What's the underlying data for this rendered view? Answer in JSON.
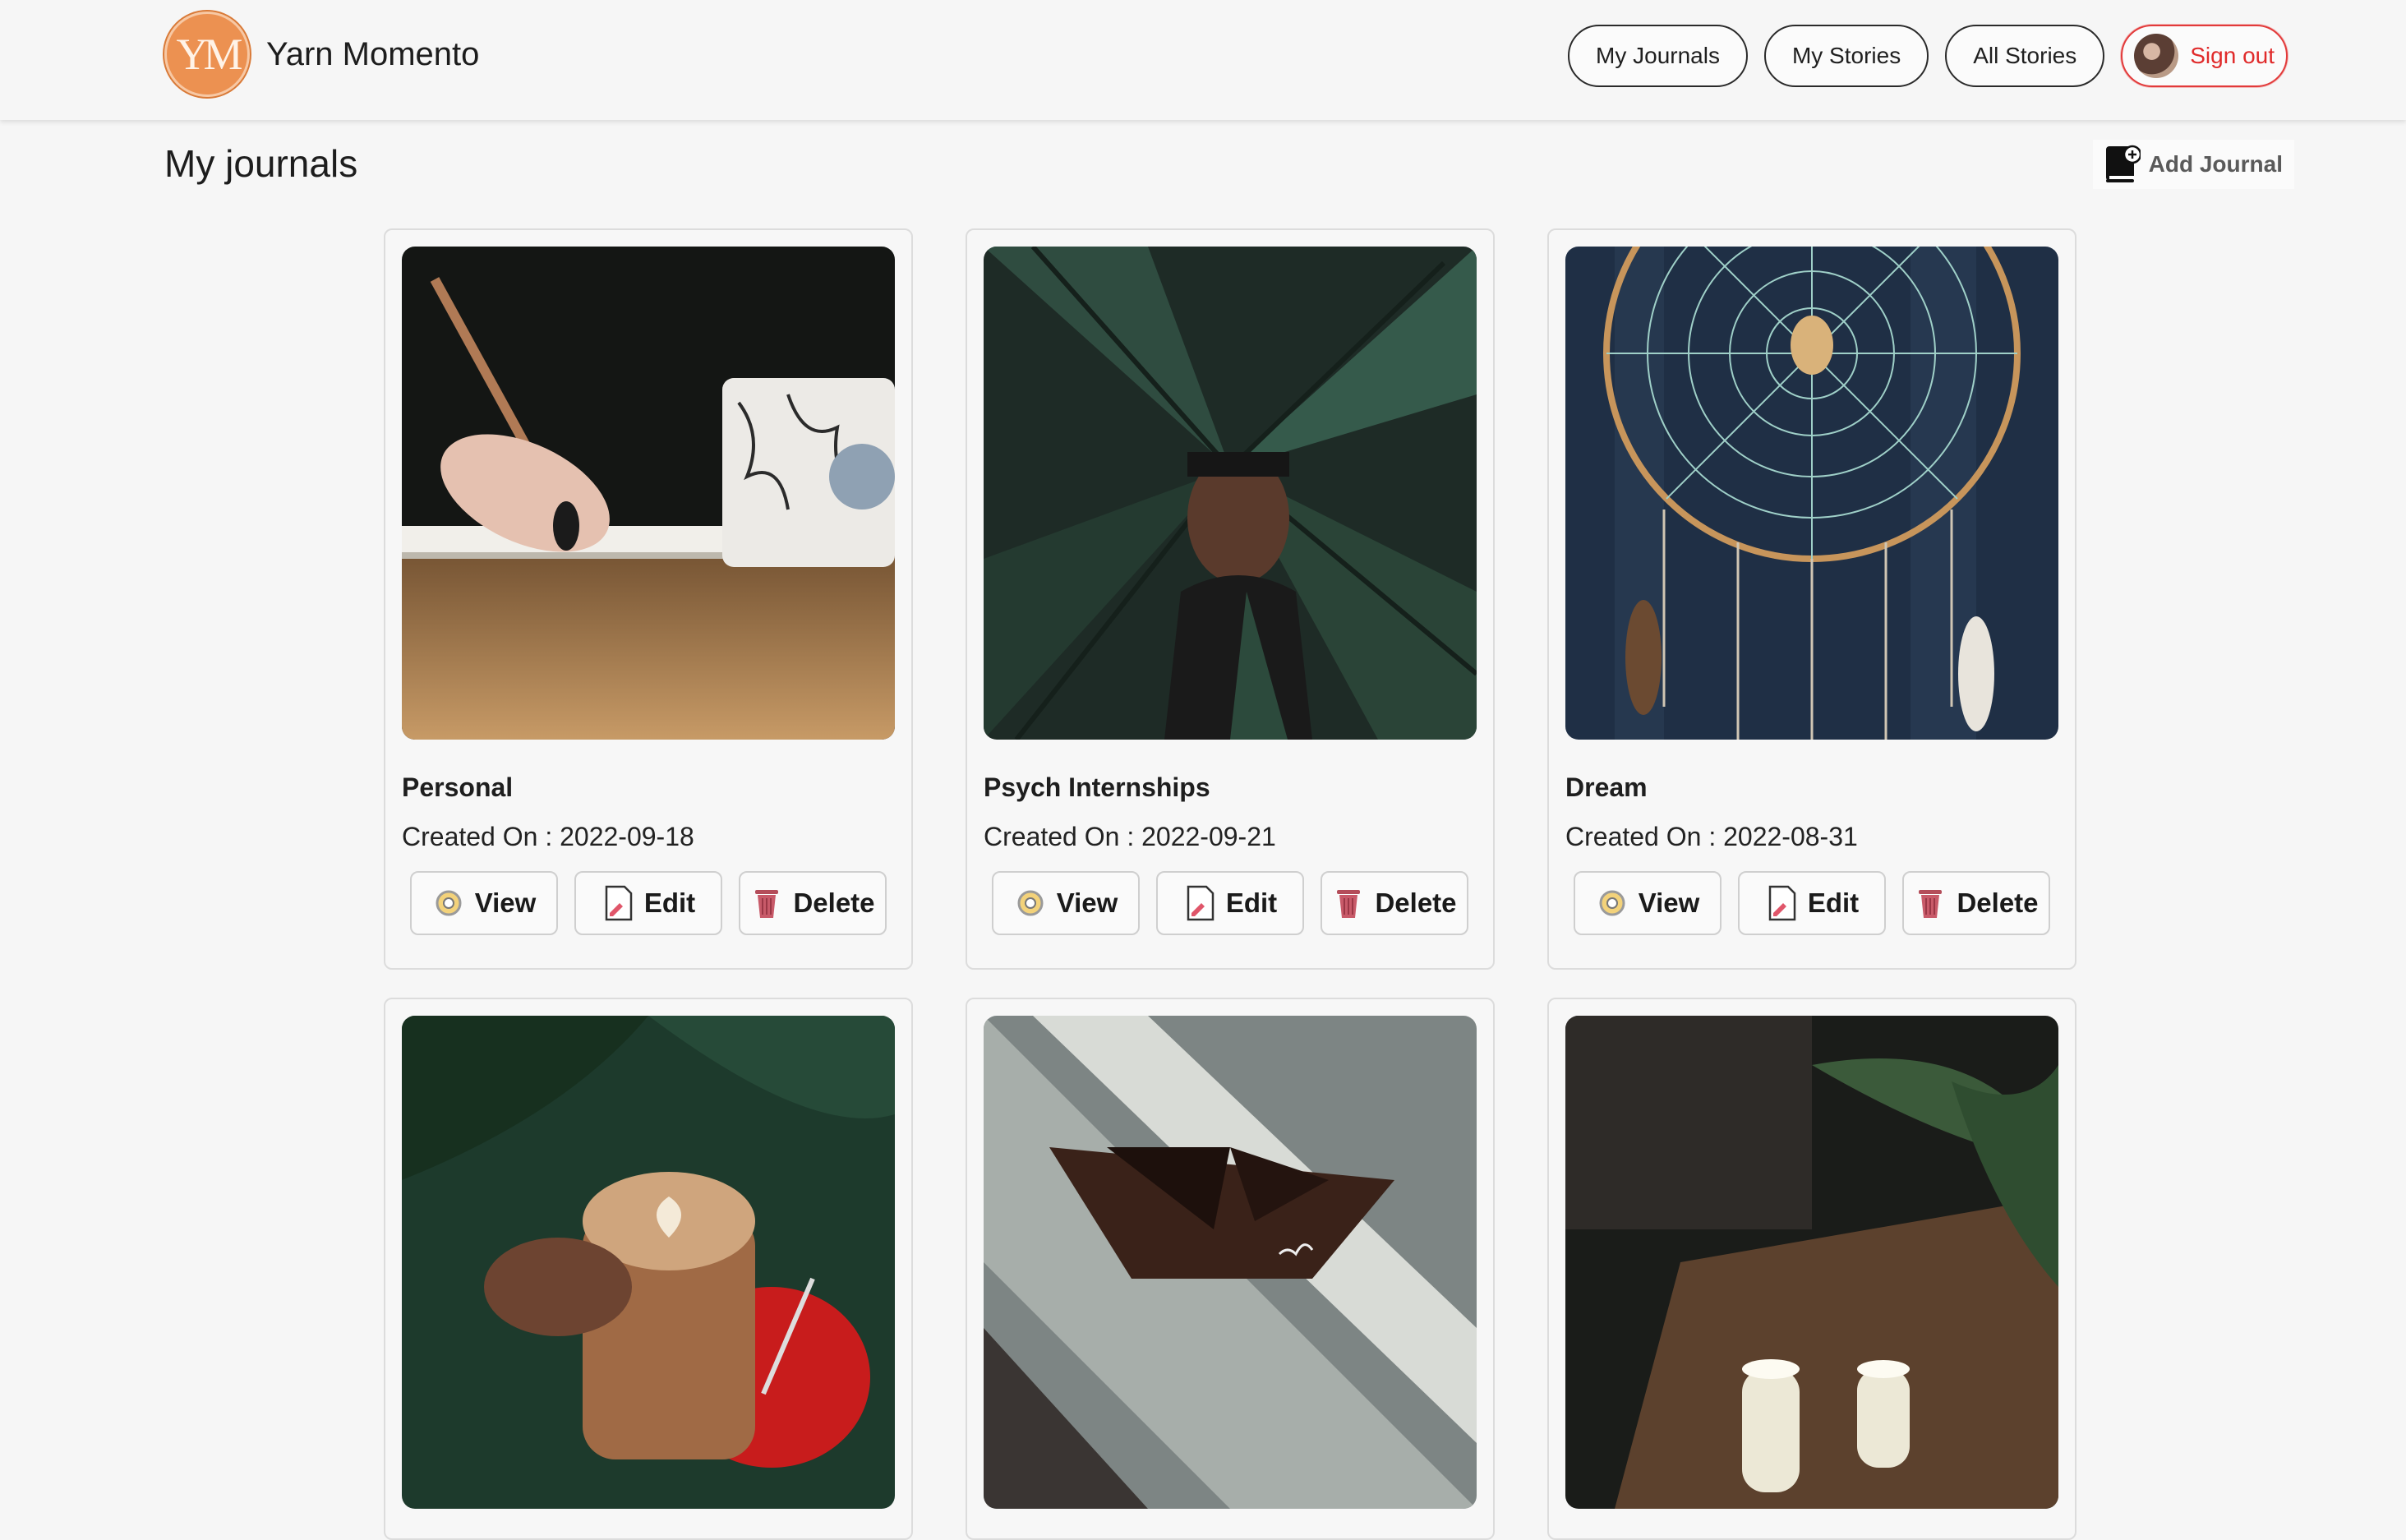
{
  "header": {
    "logo_text": "YM",
    "brand_name": "Yarn Momento",
    "nav": [
      {
        "label": "My Journals"
      },
      {
        "label": "My Stories"
      },
      {
        "label": "All Stories"
      }
    ],
    "signout_label": "Sign out"
  },
  "page": {
    "title": "My journals",
    "add_journal_label": "Add Journal"
  },
  "cards": [
    {
      "title": "Personal",
      "date_text": "Created On : 2022-09-18"
    },
    {
      "title": "Psych Internships",
      "date_text": "Created On : 2022-09-21"
    },
    {
      "title": "Dream",
      "date_text": "Created On : 2022-08-31"
    },
    {
      "title": "",
      "date_text": ""
    },
    {
      "title": "",
      "date_text": ""
    },
    {
      "title": "",
      "date_text": ""
    }
  ],
  "card_actions": {
    "view": "View",
    "edit": "Edit",
    "delete": "Delete"
  },
  "colors": {
    "accent_orange": "#ec9151",
    "signout_red": "#e02b2b"
  },
  "icons": {
    "view": "gear-view-icon",
    "edit": "document-edit-icon",
    "delete": "trash-icon",
    "add": "book-plus-icon"
  }
}
